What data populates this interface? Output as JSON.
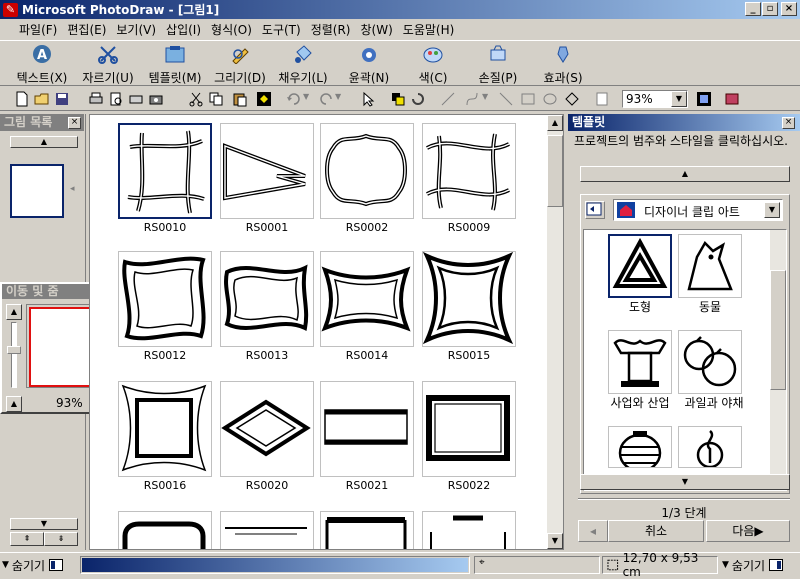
{
  "window": {
    "title": "Microsoft PhotoDraw - [그림1]"
  },
  "menu": [
    "파일(F)",
    "편집(E)",
    "보기(V)",
    "삽입(I)",
    "형식(O)",
    "도구(T)",
    "정렬(R)",
    "창(W)",
    "도움말(H)"
  ],
  "big_toolbar": [
    {
      "label": "텍스트(X)",
      "icon": "text-a-icon"
    },
    {
      "label": "자르기(U)",
      "icon": "scissors-icon"
    },
    {
      "label": "템플릿(M)",
      "icon": "template-icon"
    },
    {
      "label": "그리기(D)",
      "icon": "pencil-icon"
    },
    {
      "label": "채우기(L)",
      "icon": "paint-bucket-icon"
    },
    {
      "label": "윤곽(N)",
      "icon": "outline-icon"
    },
    {
      "label": "색(C)",
      "icon": "color-icon"
    },
    {
      "label": "손질(P)",
      "icon": "touchup-icon"
    },
    {
      "label": "효과(S)",
      "icon": "effects-icon"
    }
  ],
  "zoom": "93%",
  "picture_list": {
    "title": "그림 목록"
  },
  "pan_zoom": {
    "title": "이동 및 줌",
    "zoom": "93%"
  },
  "gallery": {
    "items": [
      "RS0010",
      "RS0001",
      "RS0002",
      "RS0009",
      "RS0012",
      "RS0013",
      "RS0014",
      "RS0015",
      "RS0016",
      "RS0020",
      "RS0021",
      "RS0022"
    ]
  },
  "template_panel": {
    "title": "템플릿",
    "instruction": "프로젝트의 범주와 스타일을 클릭하십시오.",
    "source": "디자이너 클립 아트",
    "categories": [
      "도형",
      "동물",
      "사업와 산업",
      "과일과 야채"
    ],
    "step": "1/3 단계",
    "cancel": "취소",
    "next": "다음▶"
  },
  "status": {
    "hide_left": "숨기기",
    "coords": "12,70 x 9,53 cm",
    "hide_right": "숨기기"
  },
  "colors": {
    "title_dark": "#0a246a",
    "title_light": "#a6caf0",
    "face": "#d4d0c8",
    "app_icon": "#cc0000"
  }
}
